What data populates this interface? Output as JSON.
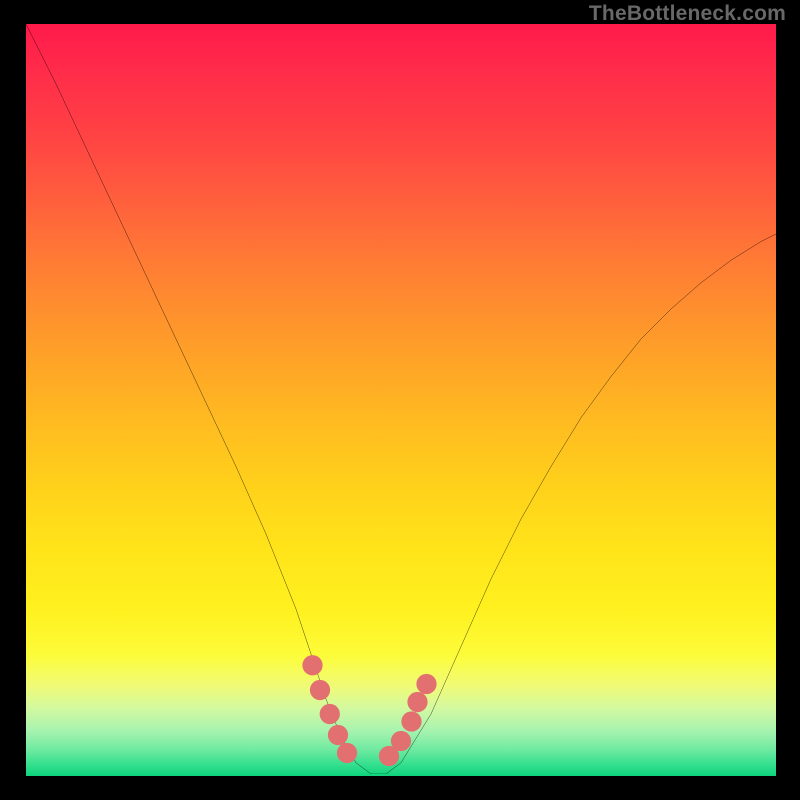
{
  "watermark": "TheBottleneck.com",
  "chart_data": {
    "type": "line",
    "title": "",
    "xlabel": "",
    "ylabel": "",
    "xlim": [
      0,
      100
    ],
    "ylim": [
      0,
      100
    ],
    "series": [
      {
        "name": "bottleneck-curve",
        "x": [
          0,
          4,
          8,
          12,
          16,
          20,
          24,
          28,
          32,
          36,
          38,
          40,
          42,
          44,
          46,
          48,
          50,
          54,
          58,
          62,
          66,
          70,
          74,
          78,
          82,
          86,
          90,
          94,
          98,
          100
        ],
        "y": [
          100,
          92,
          83.5,
          75,
          66.5,
          58,
          49.5,
          41,
          32,
          22,
          16,
          10,
          5,
          1.5,
          0,
          0,
          1.5,
          8,
          17,
          26,
          34,
          41,
          47.5,
          53,
          58,
          62,
          65.5,
          68.5,
          71,
          72
        ]
      },
      {
        "name": "marker-band",
        "type": "scatter",
        "x": [
          38.2,
          39.2,
          40.5,
          41.6,
          42.8,
          48.4,
          50.0,
          51.4,
          52.2,
          53.4
        ],
        "y": [
          14.5,
          11.2,
          8.0,
          5.2,
          2.8,
          2.4,
          4.4,
          7.0,
          9.6,
          12.0
        ]
      }
    ],
    "colors": {
      "curve": "#000000",
      "markers": "#e27070",
      "gradient_top": "#ff1a4a",
      "gradient_bottom": "#0fd47d"
    }
  }
}
